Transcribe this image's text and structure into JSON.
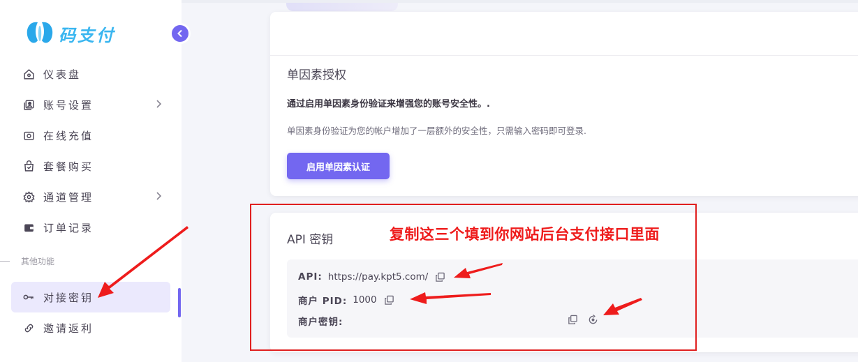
{
  "brand": {
    "name": "码支付"
  },
  "sidebar": {
    "items": [
      {
        "label": "仪表盘",
        "icon": "home-icon"
      },
      {
        "label": "账号设置",
        "icon": "account-icon",
        "has_children": true
      },
      {
        "label": "在线充值",
        "icon": "camera-icon"
      },
      {
        "label": "套餐购买",
        "icon": "bag-icon"
      },
      {
        "label": "通道管理",
        "icon": "gear-icon",
        "has_children": true
      },
      {
        "label": "订单记录",
        "icon": "wallet-icon"
      }
    ],
    "section_label": "其他功能",
    "other_items": [
      {
        "label": "对接密钥",
        "icon": "key-icon",
        "active": true
      },
      {
        "label": "邀请返利",
        "icon": "link-icon"
      }
    ]
  },
  "single_factor": {
    "title": "单因素授权",
    "bold_text": "通过启用单因素身份验证来增强您的账号安全性。.",
    "description": "单因素身份验证为您的帐户增加了一层额外的安全性，只需输入密码即可登录.",
    "button_label": "启用单因素认证"
  },
  "api_key": {
    "title": "API 密钥",
    "api_label": "API:",
    "api_value": "https://pay.kpt5.com/",
    "pid_label": "商户 PID:",
    "pid_value": "1000",
    "secret_label": "商户密钥:",
    "secret_value": ""
  },
  "annotation": {
    "text": "复制这三个填到你网站后台支付接口里面",
    "color": "#ee1c1c"
  },
  "colors": {
    "primary": "#7367f0",
    "brand": "#3ab6f0"
  }
}
